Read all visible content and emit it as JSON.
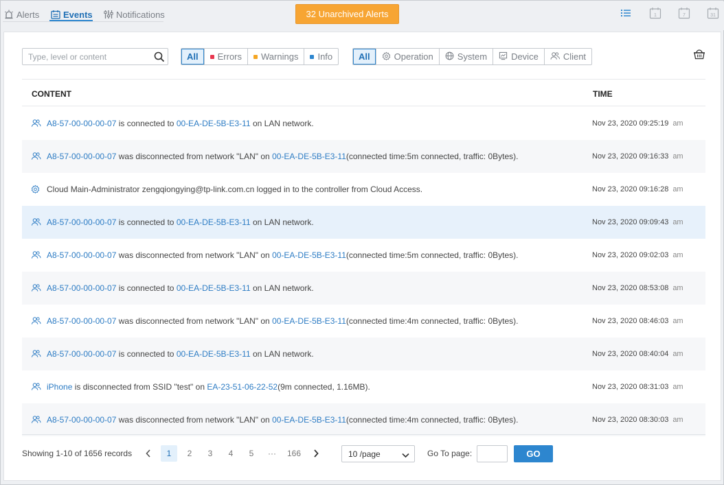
{
  "tabs": [
    {
      "label": "Alerts",
      "icon": "alarm-icon",
      "active": false
    },
    {
      "label": "Events",
      "icon": "calendar-list-icon",
      "active": true
    },
    {
      "label": "Notifications",
      "icon": "sliders-icon",
      "active": false
    }
  ],
  "unarchived_button": "32 Unarchived Alerts",
  "view_icons": [
    "list-view-icon",
    "calendar-day-icon",
    "calendar-week-icon",
    "calendar-month-icon"
  ],
  "calendar_numbers": [
    "1",
    "7",
    "31"
  ],
  "search": {
    "placeholder": "Type, level or content"
  },
  "level_filter": [
    "All",
    "Errors",
    "Warnings",
    "Info"
  ],
  "type_filter": [
    "All",
    "Operation",
    "System",
    "Device",
    "Client"
  ],
  "colors": {
    "accent": "#2d86cf",
    "alert_button": "#f7a533",
    "error": "#e8374f",
    "warning": "#f5a623",
    "info": "#2d86cf",
    "link": "#2d7cc4"
  },
  "table": {
    "col_content": "CONTENT",
    "col_time": "TIME",
    "rows": [
      {
        "icon": "client-icon",
        "link1": "A8-57-00-00-00-07",
        "text1": "is connected to",
        "link2": "00-EA-DE-5B-E3-11",
        "text2": "on LAN network.",
        "time": "Nov 23, 2020 09:25:19",
        "ampm": "am"
      },
      {
        "icon": "client-icon",
        "link1": "A8-57-00-00-00-07",
        "text1": "was disconnected from network \"LAN\" on",
        "link2": "00-EA-DE-5B-E3-11",
        "text2": "(connected time:5m connected, traffic: 0Bytes).",
        "time": "Nov 23, 2020 09:16:33",
        "ampm": "am"
      },
      {
        "icon": "operation-icon",
        "text0": "Cloud Main-Administrator zengqiongying@tp-link.com.cn logged in to the controller from Cloud Access.",
        "time": "Nov 23, 2020 09:16:28",
        "ampm": "am"
      },
      {
        "icon": "client-icon",
        "link1": "A8-57-00-00-00-07",
        "text1": "is connected to",
        "link2": "00-EA-DE-5B-E3-11",
        "text2": "on LAN network.",
        "time": "Nov 23, 2020 09:09:43",
        "ampm": "am"
      },
      {
        "icon": "client-icon",
        "link1": "A8-57-00-00-00-07",
        "text1": "was disconnected from network \"LAN\" on",
        "link2": "00-EA-DE-5B-E3-11",
        "text2": "(connected time:5m connected, traffic: 0Bytes).",
        "time": "Nov 23, 2020 09:02:03",
        "ampm": "am"
      },
      {
        "icon": "client-icon",
        "link1": "A8-57-00-00-00-07",
        "text1": "is connected to",
        "link2": "00-EA-DE-5B-E3-11",
        "text2": "on LAN network.",
        "time": "Nov 23, 2020 08:53:08",
        "ampm": "am"
      },
      {
        "icon": "client-icon",
        "link1": "A8-57-00-00-00-07",
        "text1": "was disconnected from network \"LAN\" on",
        "link2": "00-EA-DE-5B-E3-11",
        "text2": "(connected time:4m connected, traffic: 0Bytes).",
        "time": "Nov 23, 2020 08:46:03",
        "ampm": "am"
      },
      {
        "icon": "client-icon",
        "link1": "A8-57-00-00-00-07",
        "text1": "is connected to",
        "link2": "00-EA-DE-5B-E3-11",
        "text2": "on LAN network.",
        "time": "Nov 23, 2020 08:40:04",
        "ampm": "am"
      },
      {
        "icon": "client-icon",
        "link1": "iPhone",
        "text1": "is disconnected from SSID \"test\" on",
        "link2": "EA-23-51-06-22-52",
        "text2": "(9m connected, 1.16MB).",
        "time": "Nov 23, 2020 08:31:03",
        "ampm": "am"
      },
      {
        "icon": "client-icon",
        "link1": "A8-57-00-00-00-07",
        "text1": "was disconnected from network \"LAN\" on",
        "link2": "00-EA-DE-5B-E3-11",
        "text2": "(connected time:4m connected, traffic: 0Bytes).",
        "time": "Nov 23, 2020 08:30:03",
        "ampm": "am"
      }
    ]
  },
  "footer": {
    "showing": "Showing 1-10 of 1656 records",
    "pages": [
      "1",
      "2",
      "3",
      "4",
      "5",
      "···",
      "166"
    ],
    "current_page": "1",
    "per_page": "10 /page",
    "goto_label": "Go To page:",
    "goto_value": "",
    "go_button": "GO"
  }
}
